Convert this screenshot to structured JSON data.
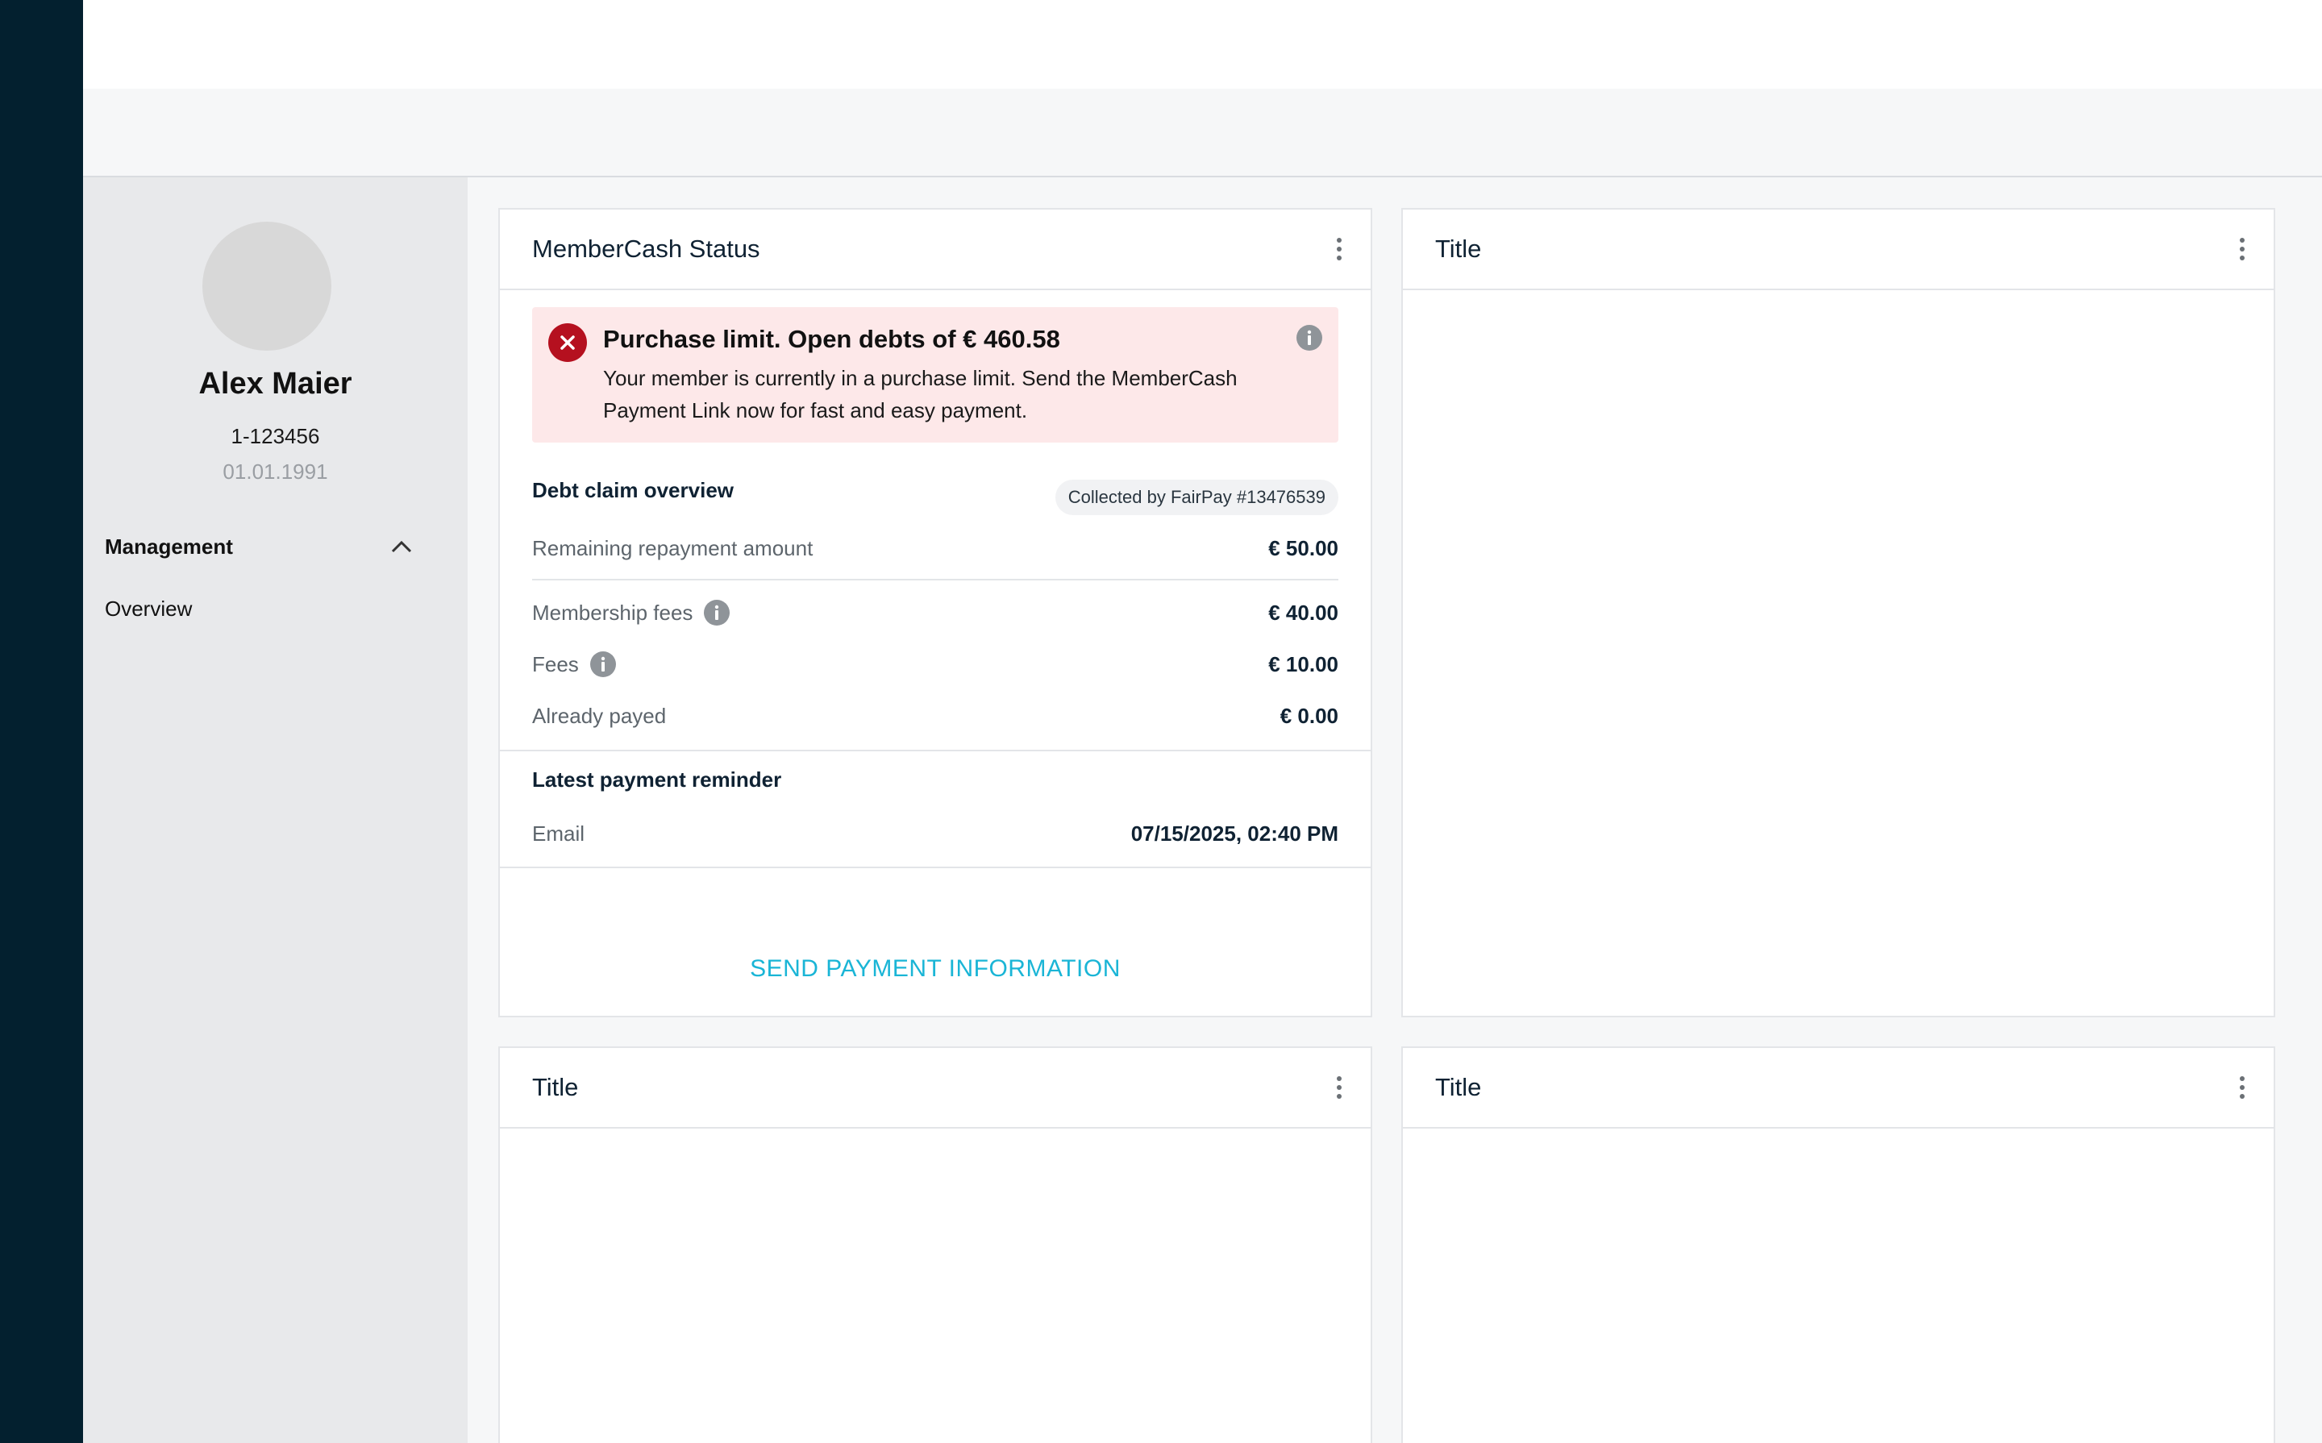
{
  "member": {
    "name": "Alex Maier",
    "id": "1-123456",
    "dob": "01.01.1991"
  },
  "sidebar": {
    "section_label": "Management",
    "items": [
      {
        "label": "Overview"
      }
    ]
  },
  "status_card": {
    "title": "MemberCash Status",
    "alert": {
      "title": "Purchase limit. Open debts of € 460.58",
      "body": "Your member is currently in a purchase limit. Send the MemberCash Payment Link now for fast and easy payment."
    },
    "debt_overview": {
      "title": "Debt claim overview",
      "badge": "Collected by FairPay #13476539",
      "rows": [
        {
          "label": "Remaining repayment amount",
          "value": "€ 50.00"
        },
        {
          "label": "Membership fees",
          "value": "€ 40.00"
        },
        {
          "label": "Fees",
          "value": "€ 10.00"
        },
        {
          "label": "Already payed",
          "value": "€ 0.00"
        }
      ]
    },
    "reminder": {
      "title": "Latest payment reminder",
      "label": "Email",
      "value": "07/15/2025, 02:40 PM"
    },
    "action_label": "SEND PAYMENT INFORMATION"
  },
  "placeholder_cards": [
    {
      "title": "Title"
    },
    {
      "title": "Title"
    },
    {
      "title": "Title"
    }
  ],
  "colors": {
    "rail": "#03202f",
    "alert_bg": "#fde8e9",
    "alert_icon": "#b5101f",
    "action": "#1ab5d6"
  },
  "icons": [
    "close-icon",
    "info-icon",
    "chevron-up-icon",
    "more-vertical-icon"
  ]
}
